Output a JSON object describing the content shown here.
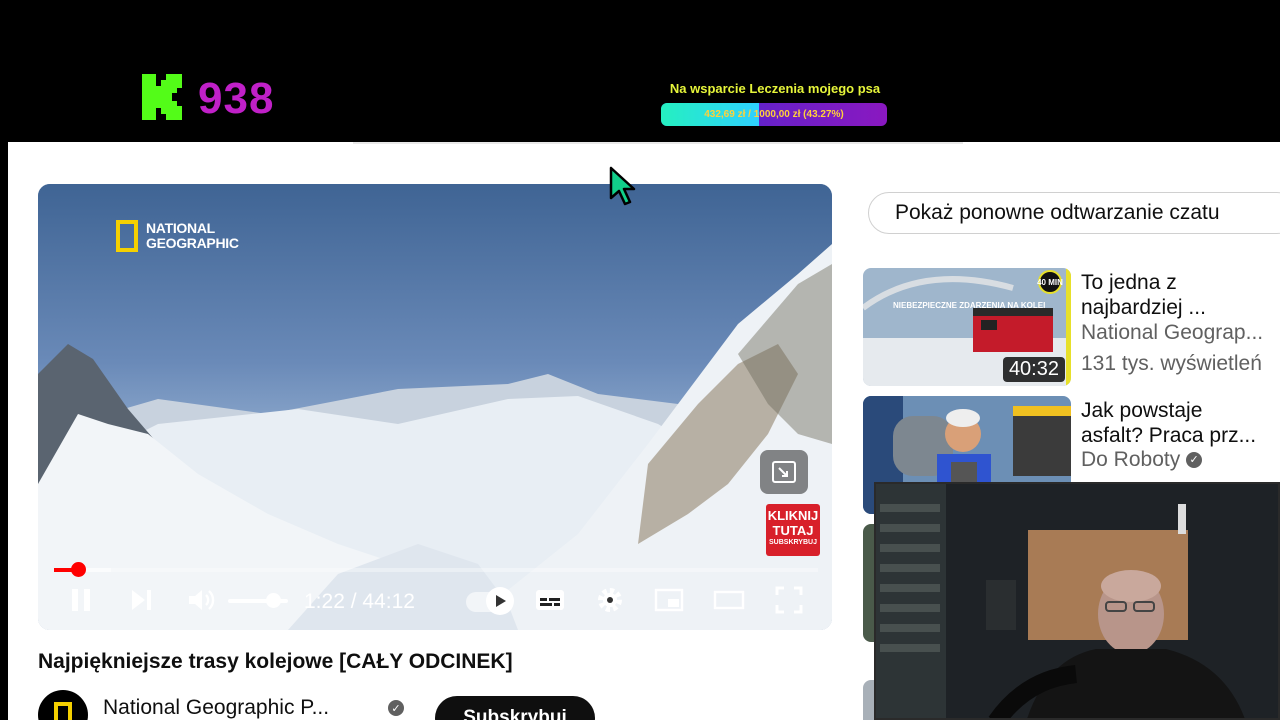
{
  "stream": {
    "viewer_count": "938",
    "goal_title": "Na wsparcie Leczenia mojego psa",
    "goal_progress_text": "432,69 zł / 1000,00 zł (43.27%)",
    "goal_progress": 0.4327,
    "colors": {
      "accent": "#53fc18",
      "viewer": "#c020c8",
      "goal_text": "#e6f53a"
    }
  },
  "player": {
    "watermark": "NATIONAL GEOGRAPHIC",
    "badge_main": "KLIKNIJ TUTAJ",
    "badge_sub": "SUBSKRYBUJ",
    "time_display": "1:22 / 44:12",
    "progress": 0.031,
    "buffered": 0.075,
    "volume": 0.75,
    "icons": [
      "pause-icon",
      "next-icon",
      "volume-icon",
      "autoplay-icon",
      "subtitles-icon",
      "settings-icon",
      "miniplayer-icon",
      "theater-icon",
      "fullscreen-icon"
    ]
  },
  "video": {
    "title": "Najpiękniejsze trasy kolejowe [CAŁY ODCINEK]",
    "channel": "National Geographic P...",
    "subscribe_label": "Subskrybuj"
  },
  "sidebar": {
    "chat_replay_label": "Pokaż ponowne odtwarzanie czatu",
    "recommendations": [
      {
        "title_line1": "To jedna z",
        "title_line2": "najbardziej ...",
        "channel": "National Geograp...",
        "views": "131 tys. wyświetleń",
        "duration": "40:32",
        "thumb_caption": "NIEBEZPIECZNE ZDARZENIA NA KOLEI",
        "thumb_badge": "40 MIN"
      },
      {
        "title_line1": "Jak powstaje",
        "title_line2": "asfalt? Praca prz...",
        "channel": "Do Roboty",
        "views": ""
      }
    ]
  }
}
